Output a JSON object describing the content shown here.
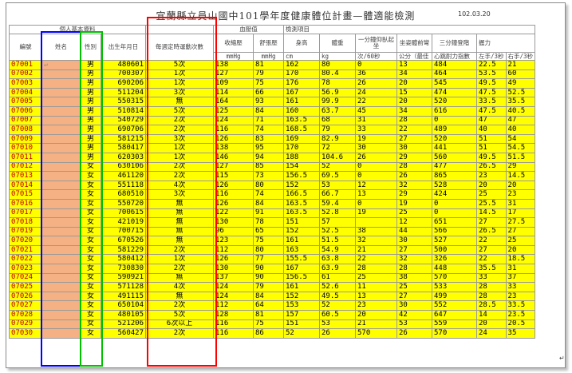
{
  "title": "宜蘭縣立員山國中101學年度健康體位計畫—體適能檢測",
  "date": "102.03.20",
  "header": {
    "group_personal": "個人基本資料",
    "group_bp": "血壓值",
    "group_test": "檢測項目",
    "col_id": "編號",
    "col_name": "姓名",
    "col_gender": "性別",
    "col_birth": "出生年月日",
    "col_exercise": "每週定時運動次數",
    "col_sys": "收縮壓",
    "col_dia": "舒張壓",
    "col_height": "身高",
    "col_weight": "體重",
    "col_situp": "一分鐘仰臥起坐",
    "col_sitreach": "坐姿體前彎",
    "col_run": "三分鐘登階",
    "col_grip": "握力",
    "unit_bp1": "mmHg",
    "unit_bp2": "mmHg",
    "unit_height": "cm",
    "unit_weight": "kg",
    "unit_situp": "次/60秒",
    "unit_sitreach": "公分（最佳",
    "unit_run": "心跳耐力指數",
    "unit_grip_l": "左手/3秒",
    "unit_grip_r": "右手/3秒",
    "row1_marker": "↵"
  },
  "rows": [
    [
      "07001",
      "",
      "男",
      "480601",
      "5次",
      "138",
      "81",
      "162",
      "80",
      "0",
      "13",
      "484",
      "22.5",
      "21"
    ],
    [
      "07002",
      "",
      "男",
      "700307",
      "1次",
      "127",
      "79",
      "170",
      "80.4",
      "36",
      "34",
      "464",
      "53.5",
      "60"
    ],
    [
      "07003",
      "",
      "男",
      "690206",
      "1次",
      "109",
      "75",
      "176",
      "78",
      "26",
      "20",
      "545",
      "49.5",
      "49"
    ],
    [
      "07004",
      "",
      "男",
      "511204",
      "3次",
      "114",
      "66",
      "167",
      "56.9",
      "24",
      "15",
      "474",
      "47.5",
      "52.5"
    ],
    [
      "07005",
      "",
      "男",
      "550315",
      "無",
      "164",
      "93",
      "161",
      "99.9",
      "22",
      "20",
      "520",
      "33.5",
      "35.5"
    ],
    [
      "07006",
      "",
      "男",
      "510814",
      "5次",
      "125",
      "84",
      "160",
      "63.7",
      "45",
      "34",
      "616",
      "47.5",
      "40.5"
    ],
    [
      "07007",
      "",
      "男",
      "540729",
      "2次",
      "124",
      "71",
      "163.5",
      "68",
      "31",
      "28",
      "0",
      "47",
      "47"
    ],
    [
      "07008",
      "",
      "男",
      "690706",
      "2次",
      "116",
      "74",
      "168.5",
      "79",
      "33",
      "22",
      "489",
      "40",
      "40"
    ],
    [
      "07009",
      "",
      "男",
      "581215",
      "3次",
      "126",
      "83",
      "169",
      "82.9",
      "19",
      "27",
      "520",
      "51",
      "54"
    ],
    [
      "07010",
      "",
      "男",
      "580417",
      "1次",
      "138",
      "95",
      "170",
      "72",
      "30",
      "30",
      "441",
      "51",
      "54.5"
    ],
    [
      "07011",
      "",
      "男",
      "620303",
      "1次",
      "146",
      "94",
      "188",
      "104.6",
      "26",
      "29",
      "560",
      "49.5",
      "51.5"
    ],
    [
      "07012",
      "",
      "女",
      "630106",
      "2次",
      "127",
      "85",
      "154",
      "52",
      "0",
      "28",
      "477",
      "26.5",
      "29"
    ],
    [
      "07013",
      "",
      "女",
      "461120",
      "2次",
      "115",
      "73",
      "156.5",
      "69.5",
      "0",
      "26",
      "865",
      "23",
      "14.5"
    ],
    [
      "07014",
      "",
      "女",
      "551118",
      "4次",
      "126",
      "80",
      "152",
      "53",
      "12",
      "32",
      "528",
      "20",
      "20"
    ],
    [
      "07015",
      "",
      "女",
      "680510",
      "3次",
      "116",
      "74",
      "166.5",
      "66.7",
      "13",
      "29",
      "424",
      "25",
      "23"
    ],
    [
      "07016",
      "",
      "女",
      "550720",
      "無",
      "126",
      "84",
      "163.5",
      "59.4",
      "0",
      "19",
      "0",
      "25.5",
      "31"
    ],
    [
      "07017",
      "",
      "女",
      "700615",
      "無",
      "122",
      "91",
      "163.5",
      "52.8",
      "19",
      "25",
      "0",
      "14.5",
      "17"
    ],
    [
      "07018",
      "",
      "女",
      "421019",
      "無",
      "130",
      "78",
      "151",
      "57",
      "",
      "12",
      "651",
      "27",
      "27.5"
    ],
    [
      "07019",
      "",
      "女",
      "700715",
      "無",
      "96",
      "65",
      "152",
      "52.5",
      "38",
      "44",
      "566",
      "26.5",
      "27"
    ],
    [
      "07020",
      "",
      "女",
      "670526",
      "無",
      "123",
      "75",
      "161",
      "51.5",
      "32",
      "30",
      "527",
      "22",
      "25"
    ],
    [
      "07021",
      "",
      "女",
      "581229",
      "2次",
      "112",
      "80",
      "163",
      "54.9",
      "21",
      "27",
      "500",
      "27",
      "20"
    ],
    [
      "07022",
      "",
      "女",
      "580412",
      "1次",
      "126",
      "77",
      "155.5",
      "63.8",
      "22",
      "32",
      "326",
      "22",
      "18.5"
    ],
    [
      "07023",
      "",
      "女",
      "730830",
      "2次",
      "130",
      "90",
      "167",
      "63.9",
      "28",
      "28",
      "448",
      "35.5",
      "31"
    ],
    [
      "07024",
      "",
      "女",
      "590921",
      "無",
      "137",
      "90",
      "156.5",
      "61",
      "25",
      "38",
      "570",
      "33",
      "37"
    ],
    [
      "07025",
      "",
      "女",
      "571128",
      "4次",
      "124",
      "79",
      "161",
      "52.6",
      "11",
      "25",
      "533",
      "28",
      "33"
    ],
    [
      "07026",
      "",
      "女",
      "491115",
      "無",
      "124",
      "84",
      "152",
      "49.5",
      "13",
      "27",
      "499",
      "28",
      "23"
    ],
    [
      "07027",
      "",
      "女",
      "650104",
      "2次",
      "112",
      "64",
      "153",
      "52",
      "23",
      "30",
      "552",
      "28.5",
      "33.5"
    ],
    [
      "07028",
      "",
      "女",
      "480105",
      "5次",
      "128",
      "81",
      "157",
      "60.5",
      "20",
      "42",
      "647",
      "14",
      "23.5"
    ],
    [
      "07029",
      "",
      "女",
      "521206",
      "6次以上",
      "116",
      "75",
      "151",
      "53",
      "21",
      "53",
      "559",
      "20",
      "20.5"
    ],
    [
      "07030",
      "",
      "女",
      "560427",
      "2次",
      "116",
      "86",
      "52",
      "26",
      "570",
      "26",
      "570",
      "24",
      "35"
    ]
  ]
}
